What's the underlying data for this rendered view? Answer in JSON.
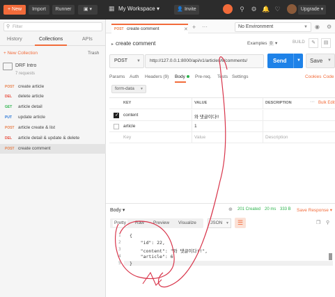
{
  "topbar": {
    "new_label": "New",
    "import_label": "Import",
    "runner_label": "Runner",
    "workspace": "My Workspace",
    "invite_label": "Invite",
    "upgrade_label": "Upgrade"
  },
  "sidebar": {
    "filter_placeholder": "Filter",
    "tabs": [
      "History",
      "Collections",
      "APIs"
    ],
    "new_collection": "+ New Collection",
    "trash": "Trash",
    "collection": {
      "name": "DRF Intro",
      "sub": "7 requests"
    },
    "requests": [
      {
        "method": "POST",
        "name": "create article",
        "color": "#e7804c"
      },
      {
        "method": "DEL",
        "name": "delete article",
        "color": "#e74c3c"
      },
      {
        "method": "GET",
        "name": "article detail",
        "color": "#2bb34b"
      },
      {
        "method": "PUT",
        "name": "update article",
        "color": "#2b77d6"
      },
      {
        "method": "POST",
        "name": "article create & list",
        "color": "#e7804c"
      },
      {
        "method": "DEL",
        "name": "article detail & update & delete",
        "color": "#e74c3c"
      },
      {
        "method": "POST",
        "name": "create comment",
        "color": "#e7804c"
      }
    ]
  },
  "main": {
    "tab": {
      "method": "POST",
      "name": "create comment"
    },
    "environment": "No Environment",
    "title": "create comment",
    "examples": "Examples",
    "examples_count": "0",
    "build": "BUILD",
    "method": "POST",
    "url": "http://127.0.0.1:8000/api/v1/articles/6/comments/",
    "send": "Send",
    "save": "Save",
    "subtabs": [
      "Params",
      "Auth",
      "Headers (9)",
      "Body",
      "Pre-req.",
      "Tests",
      "Settings"
    ],
    "cookies": "Cookies",
    "code": "Code",
    "body_type": "form-data",
    "table_headers": {
      "key": "KEY",
      "value": "VALUE",
      "description": "DESCRIPTION",
      "bulk_edit": "Bulk Edit"
    },
    "rows": [
      {
        "key": "content",
        "value": "와 댓글이다!!",
        "description": ""
      },
      {
        "key": "article",
        "value": "1",
        "description": ""
      }
    ],
    "placeholders": {
      "key": "Key",
      "value": "Value",
      "description": "Description"
    },
    "response": {
      "label": "Body",
      "status": "201 Created",
      "time": "20 ms",
      "size": "333 B",
      "save_response": "Save Response",
      "view_tabs": [
        "Pretty",
        "Raw",
        "Preview",
        "Visualize"
      ],
      "format": "JSON",
      "lines": [
        {
          "n": "1",
          "text": "{"
        },
        {
          "n": "2",
          "text": "    \"id\": 22,"
        },
        {
          "n": "3",
          "text": "    \"content\": \"와 댓글이다!!\","
        },
        {
          "n": "4",
          "text": "    \"article\": 6"
        },
        {
          "n": "5",
          "text": "}"
        }
      ]
    }
  }
}
